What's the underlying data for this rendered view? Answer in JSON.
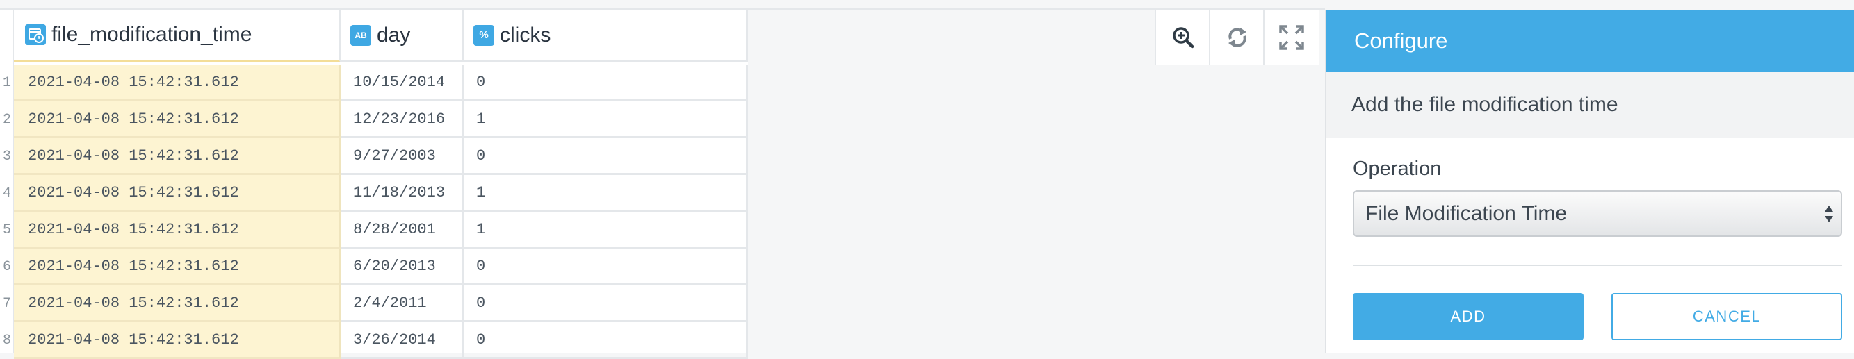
{
  "grid": {
    "columns": [
      {
        "name": "file_modification_time",
        "type_icon": "datetime-type-icon",
        "selected": true
      },
      {
        "name": "day",
        "type_icon": "string-type-icon",
        "type_text": "AB"
      },
      {
        "name": "clicks",
        "type_icon": "percent-number-type-icon",
        "type_text": "%"
      }
    ],
    "row_numbers": [
      "1",
      "2",
      "3",
      "4",
      "5",
      "6",
      "7",
      "8"
    ],
    "rows": [
      [
        "2021-04-08 15:42:31.612",
        "10/15/2014",
        "0"
      ],
      [
        "2021-04-08 15:42:31.612",
        "12/23/2016",
        "1"
      ],
      [
        "2021-04-08 15:42:31.612",
        "9/27/2003",
        "0"
      ],
      [
        "2021-04-08 15:42:31.612",
        "11/18/2013",
        "1"
      ],
      [
        "2021-04-08 15:42:31.612",
        "8/28/2001",
        "1"
      ],
      [
        "2021-04-08 15:42:31.612",
        "6/20/2013",
        "0"
      ],
      [
        "2021-04-08 15:42:31.612",
        "2/4/2011",
        "0"
      ],
      [
        "2021-04-08 15:42:31.612",
        "3/26/2014",
        "0"
      ]
    ]
  },
  "toolbar": {
    "icons": [
      "zoom-in-icon",
      "refresh-icon",
      "fullscreen-icon"
    ]
  },
  "configure": {
    "title": "Configure",
    "description": "Add the file modification time",
    "operation_label": "Operation",
    "operation_value": "File Modification Time",
    "add_label": "ADD",
    "cancel_label": "CANCEL"
  },
  "colors": {
    "accent": "#42abe5",
    "selected_column": "#fdf4d2"
  }
}
